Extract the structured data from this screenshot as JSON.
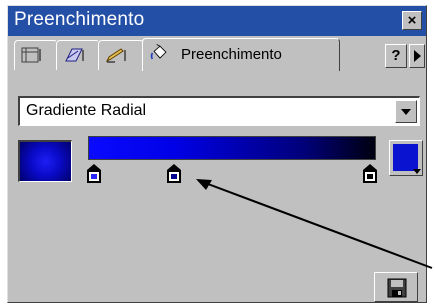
{
  "window": {
    "title": "Preenchimento",
    "close_glyph": "×"
  },
  "tabs": [
    {
      "icon": "info-panel-icon",
      "label": ""
    },
    {
      "icon": "transform-icon",
      "label": ""
    },
    {
      "icon": "stroke-pencil-icon",
      "label": ""
    },
    {
      "icon": "fill-bucket-icon",
      "label": "Preenchimento",
      "active": true
    }
  ],
  "toolbar": {
    "help_glyph": "?",
    "scroll_icon": "chevron-right-icon"
  },
  "fill": {
    "type_value": "Gradiente Radial",
    "preview_color": "#0a0ac8",
    "gradient_colors": [
      "#0a0aff",
      "#00007a",
      "#000010"
    ],
    "markers": [
      {
        "position": 0.02,
        "color": "#2828ff"
      },
      {
        "position": 0.3,
        "color": "#000090"
      },
      {
        "position": 0.98,
        "color": "#000000"
      }
    ],
    "pointer_color": "#0a14d0"
  },
  "colors": {
    "titlebar": "#244fa7",
    "panel": "#c0c0c0"
  }
}
